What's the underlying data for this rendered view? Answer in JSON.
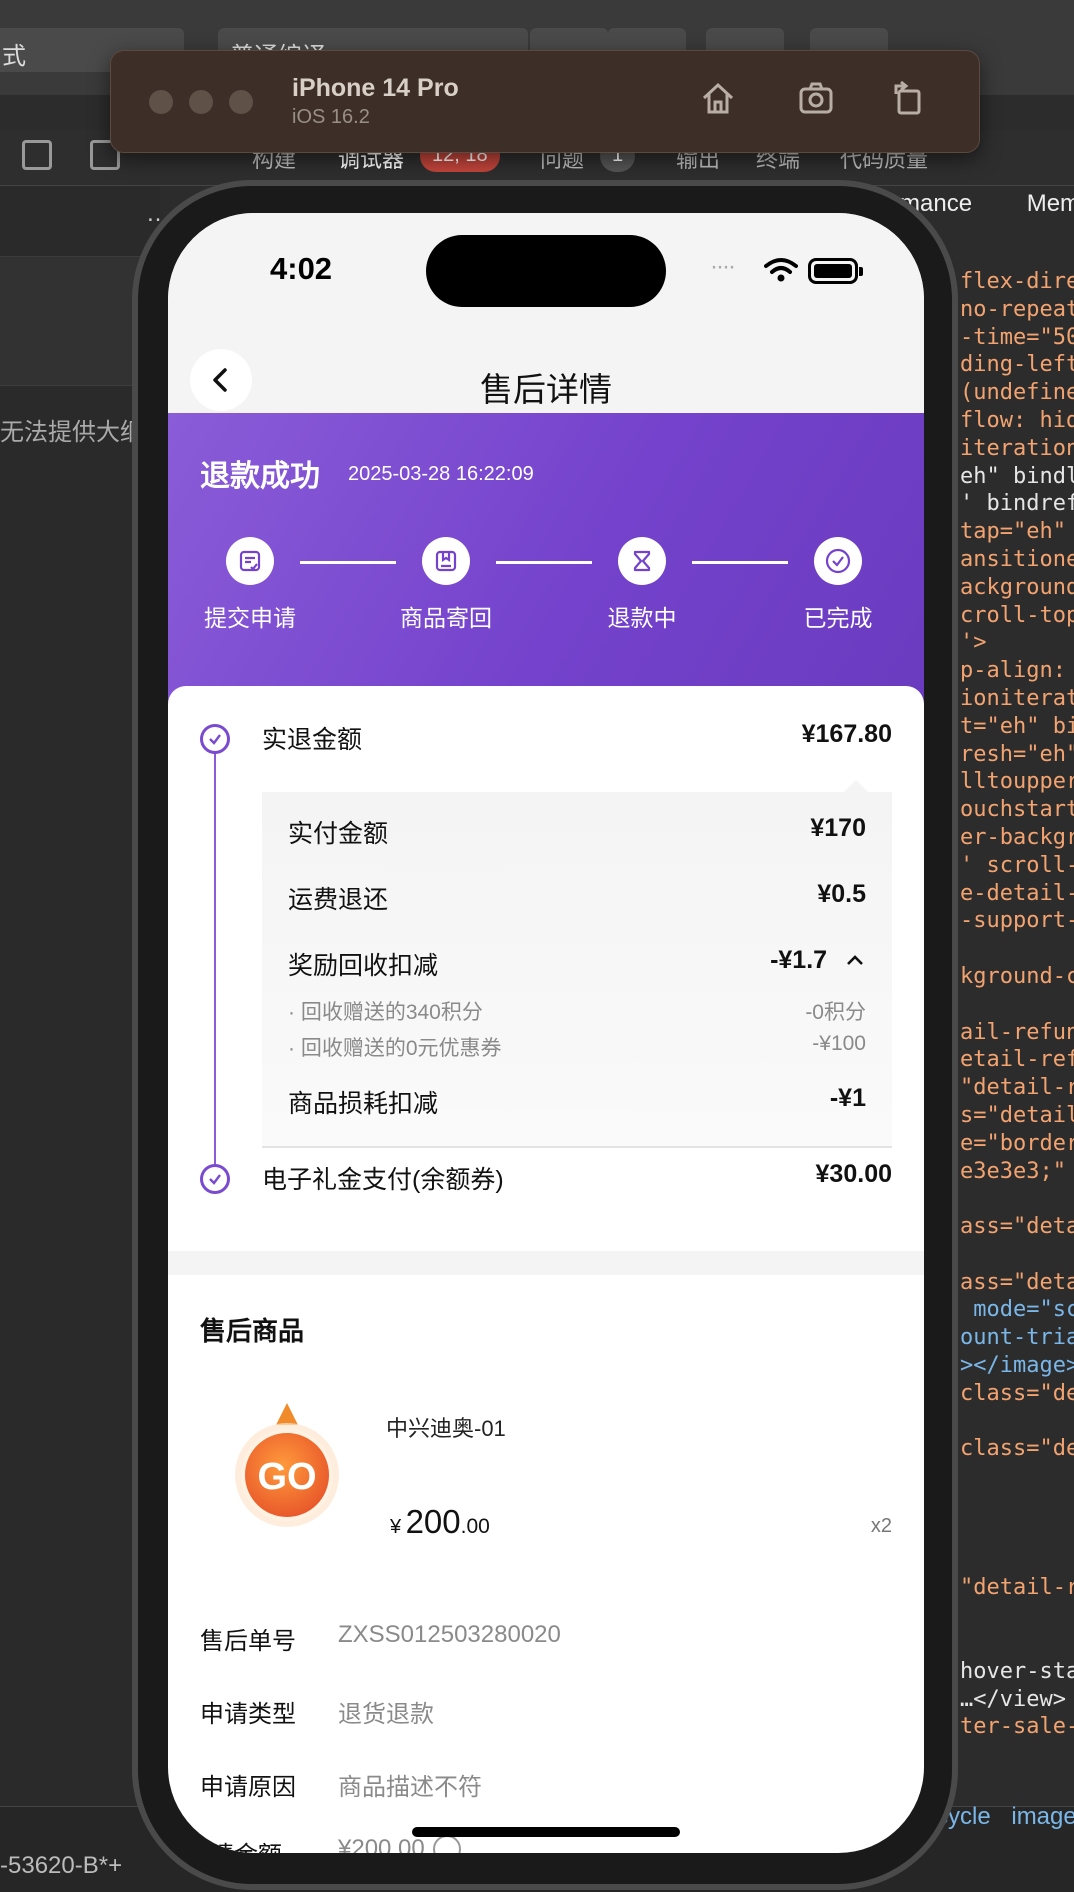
{
  "ide": {
    "compile_select": "普通编译",
    "mode_select": "式",
    "tabs": {
      "build": "构建",
      "debugger": "调试器",
      "debugger_badge": "12, 18",
      "problems": "问题",
      "problems_badge": "1",
      "output": "输出",
      "terminal": "终端",
      "code_quality": "代码质量"
    },
    "more": "…",
    "left_notice": "无法提供大纲",
    "right_tabs": [
      "mance",
      "Mem"
    ],
    "code_lines": [
      "flex-dire",
      "no-repeat",
      "-time=\"50",
      "ding-left",
      "(undefine",
      "flow: hid",
      "iteration=",
      "eh\" bindl",
      "' bindref",
      "tap=\"eh\"",
      "ansitione",
      "ackground",
      "croll-top",
      "'>",
      "p-align:",
      "ioniterat",
      "t=\"eh\" bi",
      "resh=\"eh\"",
      "lltoupper",
      "ouchstart",
      "er-backgr",
      "' scroll-",
      "e-detail-",
      "-support-",
      "",
      "kground-c",
      "",
      "ail-refun",
      "etail-ref",
      "\"detail-r",
      "s=\"detail",
      "e=\"border",
      "e3e3e3;\"",
      "",
      "ass=\"deta",
      "",
      "ass=\"deta",
      " mode=\"sca",
      "ount-trian",
      "></image>",
      "class=\"det",
      "",
      "class=\"det",
      "",
      "",
      "",
      "",
      "\"detail-r",
      "",
      "",
      "hover-sta",
      "…</view>",
      "ter-sale-c"
    ],
    "bottom_left": "-53620-B*+",
    "bottom_right": [
      "cycle",
      "image"
    ]
  },
  "simulator": {
    "device": "iPhone 14 Pro",
    "os": "iOS 16.2",
    "icons": [
      "home-icon",
      "screenshot-icon",
      "rotate-icon"
    ]
  },
  "phone": {
    "time": "4:02",
    "signal": "····",
    "nav_title": "售后详情",
    "status_title": "退款成功",
    "status_time": "2025-03-28 16:22:09",
    "steps": [
      "提交申请",
      "商品寄回",
      "退款中",
      "已完成"
    ],
    "refund": {
      "actual_refund_label": "实退金额",
      "actual_refund_value": "¥167.80",
      "details": {
        "paid_label": "实付金额",
        "paid_value": "¥170",
        "shipping_label": "运费退还",
        "shipping_value": "¥0.5",
        "reward_label": "奖励回收扣减",
        "reward_value": "-¥1.7",
        "reward_items": [
          {
            "label": "· 回收赠送的340积分",
            "value": "-0积分"
          },
          {
            "label": "· 回收赠送的0元优惠券",
            "value": "-¥100"
          }
        ],
        "wear_label": "商品损耗扣减",
        "wear_value": "-¥1"
      },
      "gift_card_label": "电子礼金支付(余额券)",
      "gift_card_value": "¥30.00"
    },
    "product_section_title": "售后商品",
    "product": {
      "name": "中兴迪奥-01",
      "logo_text": "GO",
      "price_symbol": "¥",
      "price_int": "200",
      "price_dec": ".00",
      "qty": "x2"
    },
    "info": [
      {
        "key": "售后单号",
        "value": "ZXSS012503280020"
      },
      {
        "key": "申请类型",
        "value": "退货退款"
      },
      {
        "key": "申请原因",
        "value": "商品描述不符"
      },
      {
        "key": "请金额",
        "value": "¥200.00"
      }
    ],
    "colors": {
      "brand_purple": "#7442cc",
      "price_text": "#111111",
      "muted_text": "#8a8a8a"
    }
  }
}
